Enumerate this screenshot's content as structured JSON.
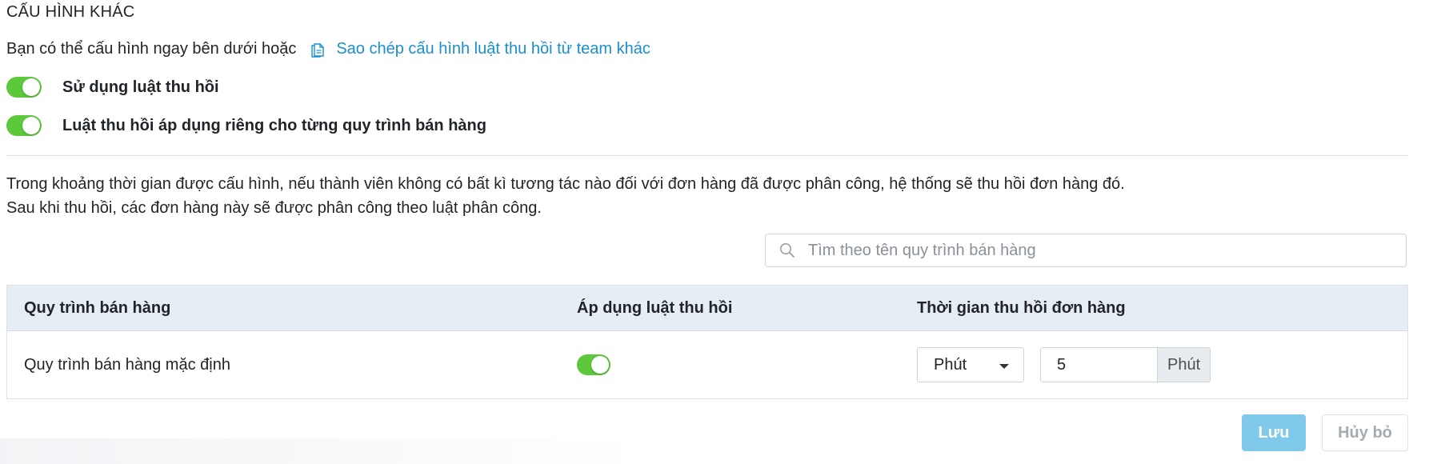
{
  "section": {
    "title": "CẤU HÌNH KHÁC",
    "intro_text": "Bạn có thể cấu hình ngay bên dưới hoặc",
    "copy_link_label": "Sao chép cấu hình luật thu hồi từ team khác",
    "copy_icon": "copy-document-icon"
  },
  "toggles": [
    {
      "label": "Sử dụng luật thu hồi",
      "enabled": true
    },
    {
      "label": "Luật thu hồi áp dụng riêng cho từng quy trình bán hàng",
      "enabled": true
    }
  ],
  "description": {
    "line1": "Trong khoảng thời gian được cấu hình, nếu thành viên không có bất kì tương tác nào đối với đơn hàng đã được phân công, hệ thống sẽ thu hồi đơn hàng đó.",
    "line2": "Sau khi thu hồi, các đơn hàng này sẽ được phân công theo luật phân công."
  },
  "search": {
    "placeholder": "Tìm theo tên quy trình bán hàng",
    "value": "",
    "icon": "search-icon"
  },
  "table": {
    "headers": [
      "Quy trình bán hàng",
      "Áp dụng luật thu hồi",
      "Thời gian thu hồi đơn hàng"
    ],
    "rows": [
      {
        "process": "Quy trình bán hàng mặc định",
        "apply": true,
        "unit_select": "Phút",
        "duration_value": "5",
        "duration_unit": "Phút"
      }
    ]
  },
  "actions": {
    "save_label": "Lưu",
    "cancel_label": "Hủy bỏ"
  },
  "colors": {
    "toggle_on": "#5cc83c",
    "link": "#1a8fd0",
    "save_button": "#7fc9ea",
    "table_header_bg": "#e6edf5"
  }
}
